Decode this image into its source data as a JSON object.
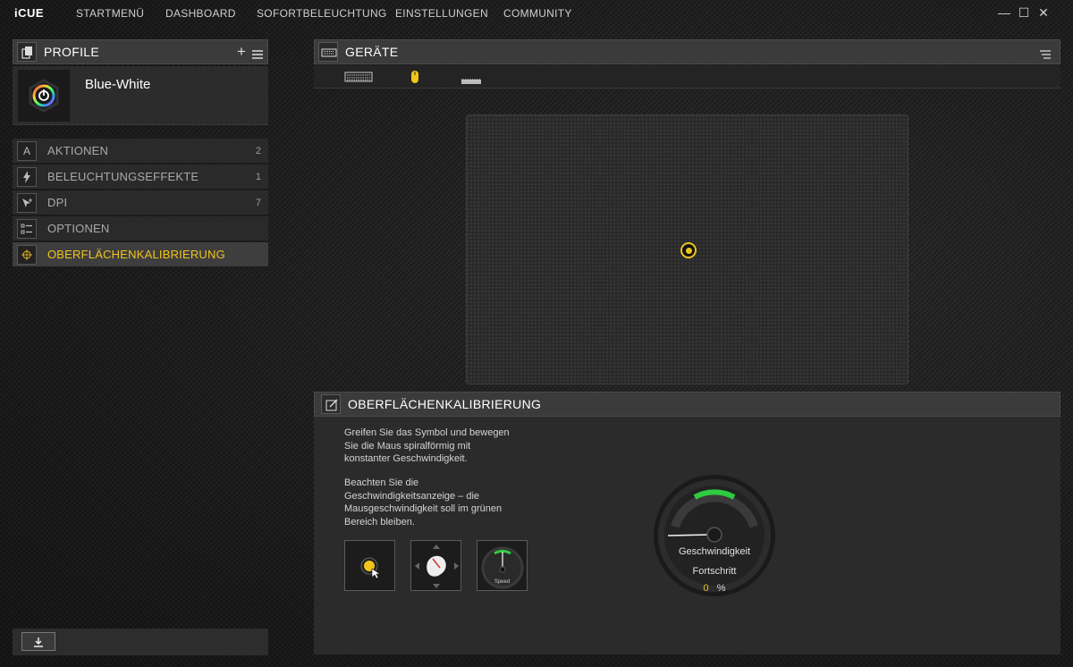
{
  "app": {
    "logo": "iCUE"
  },
  "nav": [
    "STARTMENÜ",
    "DASHBOARD",
    "SOFORTBELEUCHTUNG",
    "EINSTELLUNGEN",
    "COMMUNITY"
  ],
  "window_controls": {
    "minimize": "—",
    "maximize": "☐",
    "close": "✕"
  },
  "profiles": {
    "title": "PROFILE",
    "add_icon": "plus-icon",
    "menu_icon": "hamburger-icon",
    "current": {
      "name": "Blue-White"
    }
  },
  "sidebar": {
    "items": [
      {
        "label": "AKTIONEN",
        "count": "2",
        "icon": "letter-a-icon"
      },
      {
        "label": "BELEUCHTUNGSEFFEKTE",
        "count": "1",
        "icon": "lightning-icon"
      },
      {
        "label": "DPI",
        "count": "7",
        "icon": "dpi-icon"
      },
      {
        "label": "OPTIONEN",
        "count": "",
        "icon": "options-icon"
      },
      {
        "label": "OBERFLÄCHENKALIBRIERUNG",
        "count": "",
        "icon": "crosshair-icon",
        "active": true
      }
    ]
  },
  "devices": {
    "title": "GERÄTE",
    "list": [
      "keyboard",
      "mouse",
      "mousepad"
    ]
  },
  "calibration": {
    "title": "OBERFLÄCHENKALIBRIERUNG",
    "instructions_1": [
      "Greifen Sie das Symbol und bewegen",
      "Sie die Maus spiralförmig mit",
      "konstanter Geschwindigkeit."
    ],
    "instructions_2": [
      "Beachten Sie die",
      "Geschwindigkeitsanzeige – die",
      "Mausgeschwindigkeit soll im grünen",
      "Bereich bleiben."
    ],
    "tile_speed_label": "Speed",
    "gauge_label": "Geschwindigkeit",
    "progress_label": "Fortschritt",
    "progress_value": "0",
    "progress_unit": "%"
  },
  "colors": {
    "accent": "#f0c419",
    "green": "#2ecc40"
  }
}
